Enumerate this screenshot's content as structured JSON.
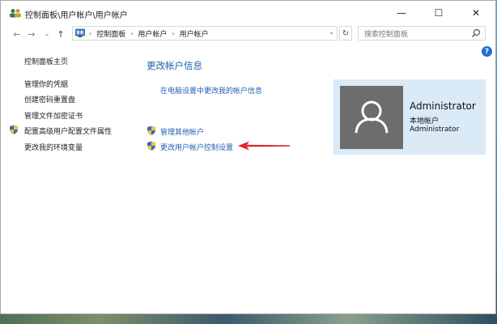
{
  "window": {
    "title": "控制面板\\用户帐户\\用户帐户",
    "buttons": {
      "minimize": "—",
      "maximize": "☐",
      "close": "✕"
    }
  },
  "nav": {
    "back": "←",
    "forward": "→",
    "recent": "⌄",
    "up": "↑",
    "breadcrumb": [
      "控制面板",
      "用户帐户",
      "用户帐户"
    ],
    "separator": "›",
    "dropdown": "⌄",
    "refresh": "↻",
    "search_placeholder": "搜索控制面板"
  },
  "help": "?",
  "sidebar": {
    "items": [
      "控制面板主页",
      "管理你的凭据",
      "创建密码重置盘",
      "管理文件加密证书",
      "配置高级用户配置文件属性",
      "更改我的环境变量"
    ]
  },
  "main": {
    "title": "更改帐户信息",
    "links": [
      "在电脑设置中更改我的帐户信息",
      "管理其他帐户",
      "更改用户帐户控制设置"
    ]
  },
  "account": {
    "name": "Administrator",
    "type": "本地帐户",
    "group": "Administrator"
  },
  "colors": {
    "link": "#1f5fb0",
    "card": "#daeaf7",
    "arrow": "#e0262b"
  }
}
